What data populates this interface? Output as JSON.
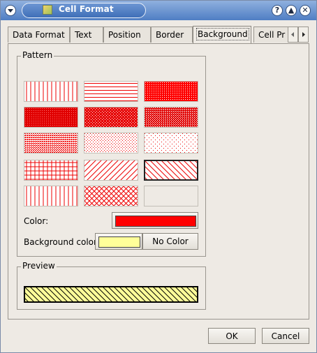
{
  "window": {
    "title": "Cell Format"
  },
  "titlebar_buttons": [
    "?",
    "▲",
    "✕"
  ],
  "tabs": [
    {
      "label": "Data Format"
    },
    {
      "label": "Text"
    },
    {
      "label": "Position"
    },
    {
      "label": "Border"
    },
    {
      "label": "Background",
      "active": true
    },
    {
      "label": "Cell Pr"
    }
  ],
  "pattern": {
    "title": "Pattern",
    "swatches": [
      "vertical-lines",
      "horizontal-lines",
      "dense-dots-1",
      "dense-dots-2",
      "dense-dots-3",
      "dense-dots-4",
      "medium-dots",
      "sparse-dots",
      "very-sparse-dots",
      "grid",
      "diagonal-forward",
      "diagonal-back-selected",
      "vertical-lines-2",
      "diagonal-cross",
      "empty"
    ],
    "selected": "diagonal-back-selected",
    "color_label": "Color:",
    "color_value": "#ff0000",
    "bg_color_label": "Background color:",
    "bg_color_value": "#ffff99",
    "no_color_label": "No Color"
  },
  "preview": {
    "title": "Preview"
  },
  "footer": {
    "ok": "OK",
    "cancel": "Cancel"
  }
}
